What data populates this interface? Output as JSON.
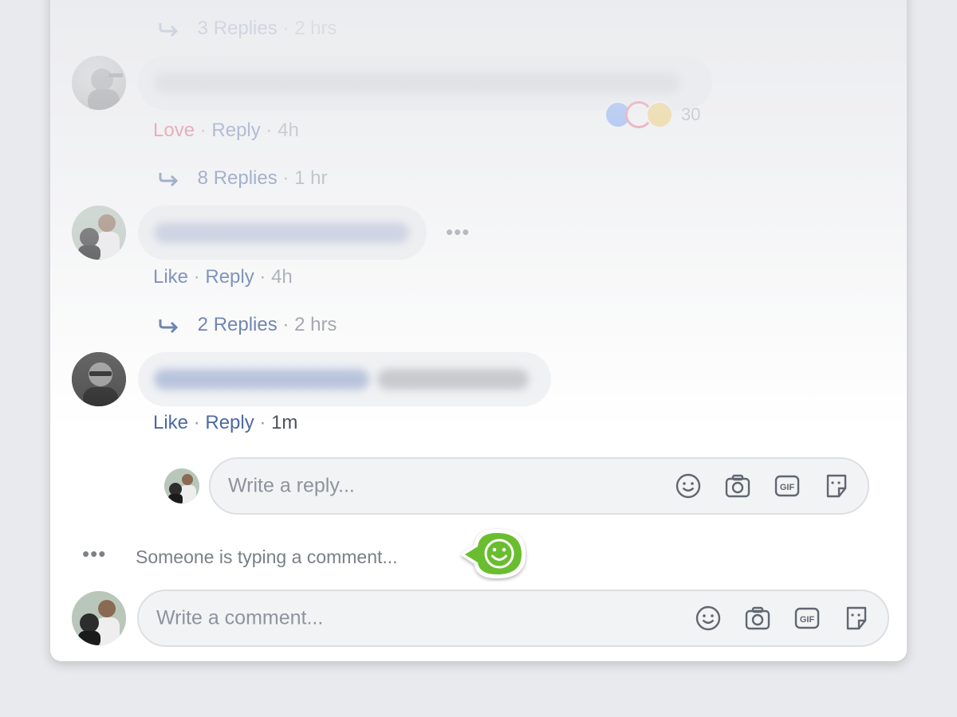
{
  "comments": [
    {
      "reply_count_label": "3 Replies",
      "reply_time": "2 hrs"
    },
    {
      "action1": "Love",
      "action2": "Reply",
      "time": "4h",
      "reaction_count": "30",
      "reply_count_label": "8 Replies",
      "reply_time": "1 hr"
    },
    {
      "action1": "Like",
      "action2": "Reply",
      "time": "4h",
      "more": "•••",
      "reply_count_label": "2 Replies",
      "reply_time": "2 hrs"
    },
    {
      "action1": "Like",
      "action2": "Reply",
      "time": "1m"
    }
  ],
  "separator": "·",
  "reply_box": {
    "placeholder": "Write a reply..."
  },
  "typing_indicator": {
    "dots": "•••",
    "text": "Someone is typing a comment..."
  },
  "comment_box": {
    "placeholder": "Write a comment..."
  },
  "icons": [
    "emoji-icon",
    "camera-icon",
    "gif-icon",
    "sticker-icon"
  ],
  "colors": {
    "link": "#4b67a1",
    "love": "#e0405a",
    "badge": "#6abd2f",
    "muted": "#90949c"
  }
}
